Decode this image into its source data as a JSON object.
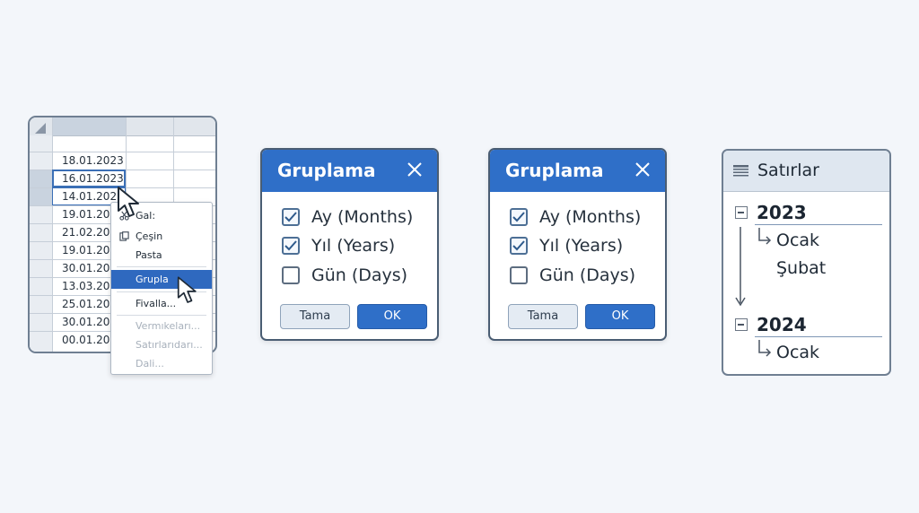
{
  "sheet": {
    "dates": [
      "18.01.2023",
      "16.01.2023",
      "14.01.2023",
      "19.01.2023",
      "21.02.2023",
      "19.01.2023",
      "30.01.2023",
      "13.03.2023",
      "25.01.2023",
      "30.01.2023",
      "00.01.2023"
    ]
  },
  "context_menu": {
    "items": [
      {
        "label": "Gal:",
        "icon": "scissors-icon"
      },
      {
        "label": "Çeşin",
        "icon": "paste-icon"
      },
      {
        "label": "Pasta"
      },
      {
        "label": "Grupla",
        "highlighted": true
      },
      {
        "label": "Fivalla..."
      },
      {
        "label": "Vermıkeları...",
        "disabled": true
      },
      {
        "label": "Satırlarıdarı...",
        "disabled": true
      },
      {
        "label": "Dali...",
        "disabled": true
      }
    ]
  },
  "dialogs": [
    {
      "title": "Gruplama",
      "options": [
        {
          "label": "Ay (Months)",
          "checked": true
        },
        {
          "label": "Yıl (Years)",
          "checked": true
        },
        {
          "label": "Gün (Days)",
          "checked": false
        }
      ],
      "cancel_label": "Tama",
      "ok_label": "OK"
    },
    {
      "title": "Gruplama",
      "options": [
        {
          "label": "Ay (Months)",
          "checked": true
        },
        {
          "label": "Yıl (Years)",
          "checked": true
        },
        {
          "label": "Gün (Days)",
          "checked": false
        }
      ],
      "cancel_label": "Tama",
      "ok_label": "OK"
    }
  ],
  "rows_panel": {
    "title": "Satırlar",
    "groups": [
      {
        "year": "2023",
        "months": [
          "Ocak",
          "Şubat"
        ]
      },
      {
        "year": "2024",
        "months": [
          "Ocak"
        ]
      }
    ]
  },
  "colors": {
    "accent": "#2f6fc8",
    "menu_highlight": "#2f69bf",
    "background": "#f3f6fa"
  }
}
